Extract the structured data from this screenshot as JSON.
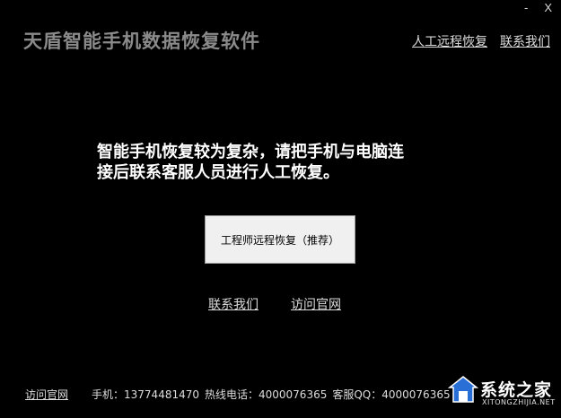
{
  "window_controls": {
    "minimize": "-",
    "close": "X"
  },
  "app_title": "天盾智能手机数据恢复软件",
  "top_links": [
    "人工远程恢复",
    "联系我们"
  ],
  "message": {
    "line1": "智能手机恢复较为复杂，请把手机与电脑连",
    "line2": "接后联系客服人员进行人工恢复。"
  },
  "primary_button": "工程师远程恢复（推荐）",
  "mid_links": [
    "联系我们",
    "访问官网"
  ],
  "footer": {
    "link": "访问官网",
    "phone": "手机：13774481470",
    "hotline": "热线电话：4000076365",
    "qq": "客服QQ：4000076365"
  },
  "watermark": {
    "text": "系统之家",
    "sub": "XITONGZHIJIA.NET",
    "icon": "house-logo-icon"
  },
  "colors": {
    "background": "#000000",
    "title": "#8a8a8a",
    "button": "#f0f0f0",
    "link": "#dcdcdc"
  }
}
